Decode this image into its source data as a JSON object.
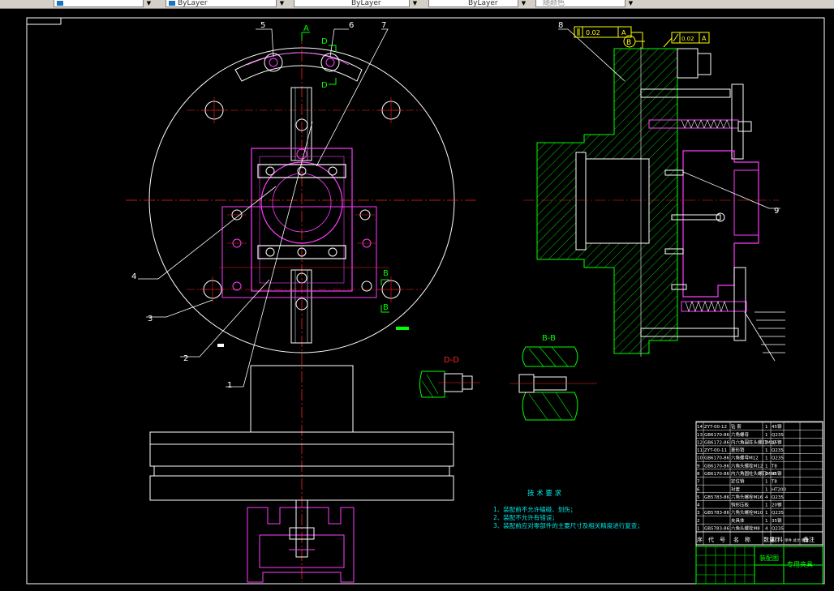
{
  "toolbar": {
    "layer_value": "",
    "color_value": "ByLayer",
    "linetype_value": "ByLayer",
    "lineweight_value": "ByLayer",
    "plotstyle_value": "随颜色"
  },
  "drawing": {
    "balloons": [
      "1",
      "2",
      "3",
      "4",
      "5",
      "6",
      "7",
      "8",
      "9"
    ],
    "section_marks": {
      "a": "A",
      "b": "B",
      "d": "D"
    },
    "view_labels": {
      "dd": "D-D",
      "bb": "B-B"
    },
    "tolerance_1": {
      "value": "0.02",
      "datum": "A"
    },
    "tolerance_2": {
      "value": "0.02",
      "datum": "A"
    },
    "datum_b": "B",
    "tech_title": "技 术 要 求",
    "tech_notes": [
      "1、装配前不允许磕碰、划伤；",
      "2、装配不允许有错误；",
      "3、装配前应对零部件的主要尺寸及相关精度进行复查；"
    ],
    "title_block": {
      "drawing_name": "装配图",
      "product_name": "专用夹具",
      "header_cols": [
        "序",
        "代　号",
        "名　称",
        "数量",
        "材料",
        "单件 总计 重量",
        "备注"
      ],
      "rows": [
        [
          "14",
          "ZYT-00-12",
          "钻 套",
          "1",
          "45钢"
        ],
        [
          "13",
          "GB6170-86",
          "六角螺母",
          "1",
          "Q235"
        ],
        [
          "12",
          "GB6172-86",
          "内六角圆柱头螺钉M12",
          "1",
          "45钢"
        ],
        [
          "11",
          "ZYT-00-11",
          "菱形销",
          "1",
          "Q235"
        ],
        [
          "10",
          "GB6170-86",
          "六角螺母M12",
          "1",
          "Q235"
        ],
        [
          "9",
          "GB6170-86",
          "六角头螺栓M12",
          "1",
          "T8"
        ],
        [
          "8",
          "GB6170-86",
          "内六角圆柱头螺钉M10",
          "1",
          "45钢"
        ],
        [
          "7",
          "",
          "定位销",
          "1",
          "T8"
        ],
        [
          "6",
          "",
          "衬套",
          "1",
          "HT200"
        ],
        [
          "5",
          "GB5783-86",
          "六角头螺栓M16",
          "4",
          "Q235"
        ],
        [
          "4",
          "",
          "钩形压板",
          "1",
          "20钢"
        ],
        [
          "3",
          "GB5783-86",
          "六角头螺栓M10",
          "1",
          "Q235"
        ],
        [
          "2",
          "",
          "夹具体",
          "1",
          "35钢"
        ],
        [
          "1",
          "GB5783-86",
          "六角头螺栓M8",
          "4",
          "Q235"
        ]
      ]
    }
  }
}
